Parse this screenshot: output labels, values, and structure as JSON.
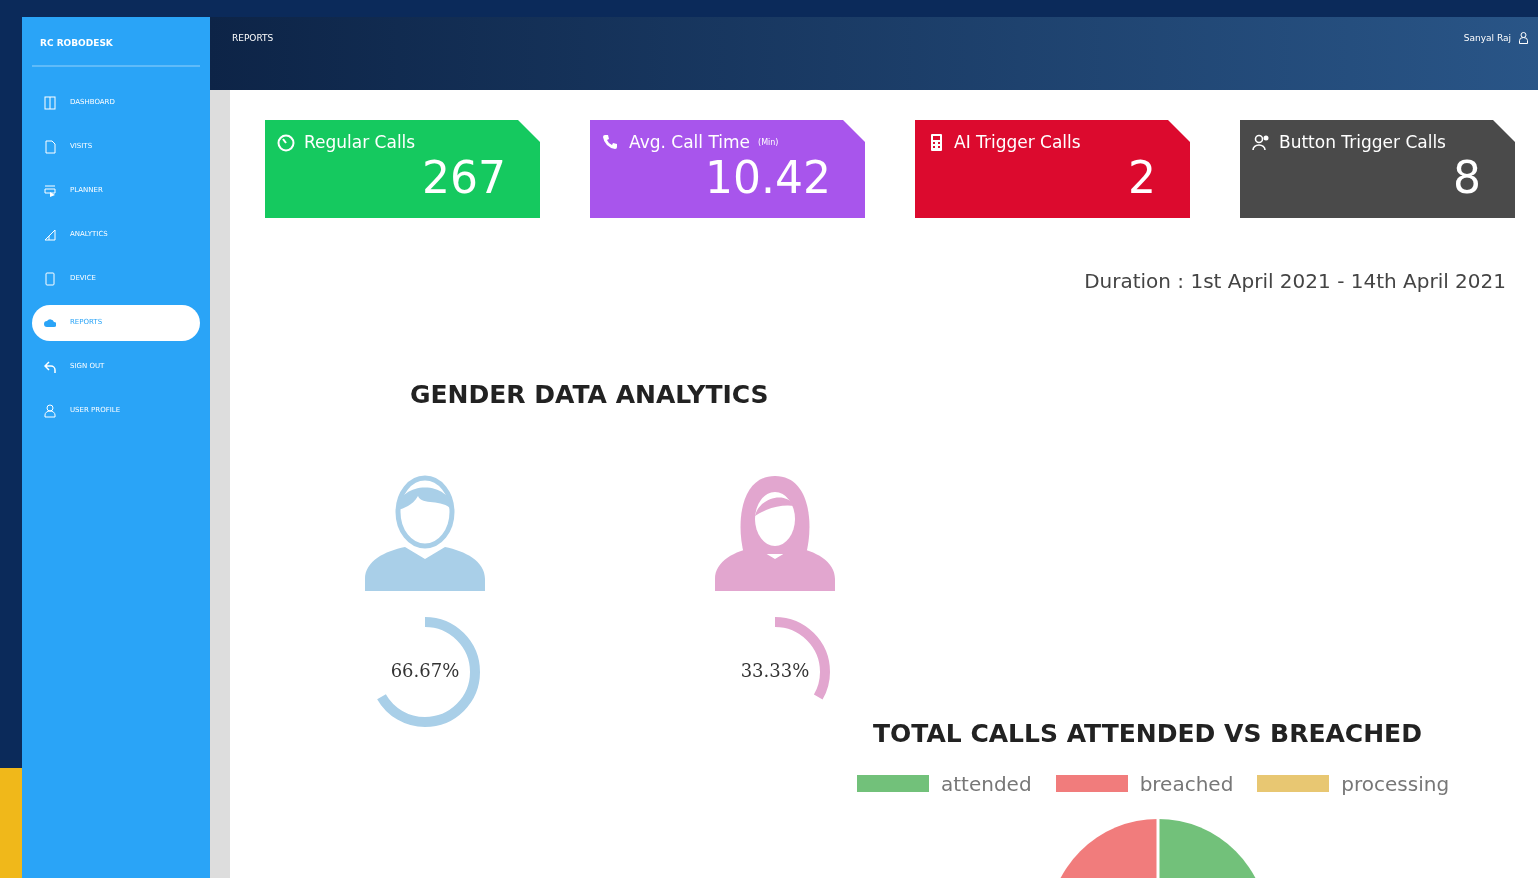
{
  "sidebar": {
    "brand": "RC ROBODESK",
    "items": [
      {
        "label": "DASHBOARD",
        "kind": "columns",
        "selected": false
      },
      {
        "label": "VISITS",
        "kind": "document",
        "selected": false
      },
      {
        "label": "PLANNER",
        "kind": "tray",
        "selected": false
      },
      {
        "label": "ANALYTICS",
        "kind": "chart",
        "selected": false
      },
      {
        "label": "DEVICE",
        "kind": "tablet",
        "selected": false
      },
      {
        "label": "REPORTS",
        "kind": "cloud",
        "selected": true
      },
      {
        "label": "SIGN OUT",
        "kind": "back",
        "selected": false
      },
      {
        "label": "USER PROFILE",
        "kind": "user",
        "selected": false
      }
    ]
  },
  "header": {
    "title": "REPORTS",
    "user": "Sanyal Raj"
  },
  "stats": [
    {
      "kind": "timer",
      "label": "Regular Calls",
      "value": "267",
      "color": "#15c95f"
    },
    {
      "kind": "phone",
      "label": "Avg. Call Time",
      "unit": "(Min)",
      "value": "10.42",
      "color": "#a855ec"
    },
    {
      "kind": "calc",
      "label": "AI Trigger Calls",
      "value": "2",
      "color": "#dc0a2e"
    },
    {
      "kind": "people",
      "label": "Button Trigger Calls",
      "value": "8",
      "color": "#4a4a4a"
    }
  ],
  "duration": "Duration : 1st April 2021 - 14th April 2021",
  "gender": {
    "title": "GENDER DATA ANALYTICS",
    "items": [
      {
        "kind": "male",
        "reading": "66.67%",
        "level": 0.6667,
        "color": "#a9cfe8"
      },
      {
        "kind": "female",
        "reading": "33.33%",
        "level": 0.3333,
        "color": "#e2a6cf"
      }
    ]
  },
  "calls": {
    "title": "TOTAL CALLS ATTENDED VS BREACHED",
    "legend": [
      {
        "label": "attended",
        "color": "#72c17a"
      },
      {
        "label": "breached",
        "color": "#f17c7c"
      },
      {
        "label": "processing",
        "color": "#e8c772"
      }
    ]
  }
}
